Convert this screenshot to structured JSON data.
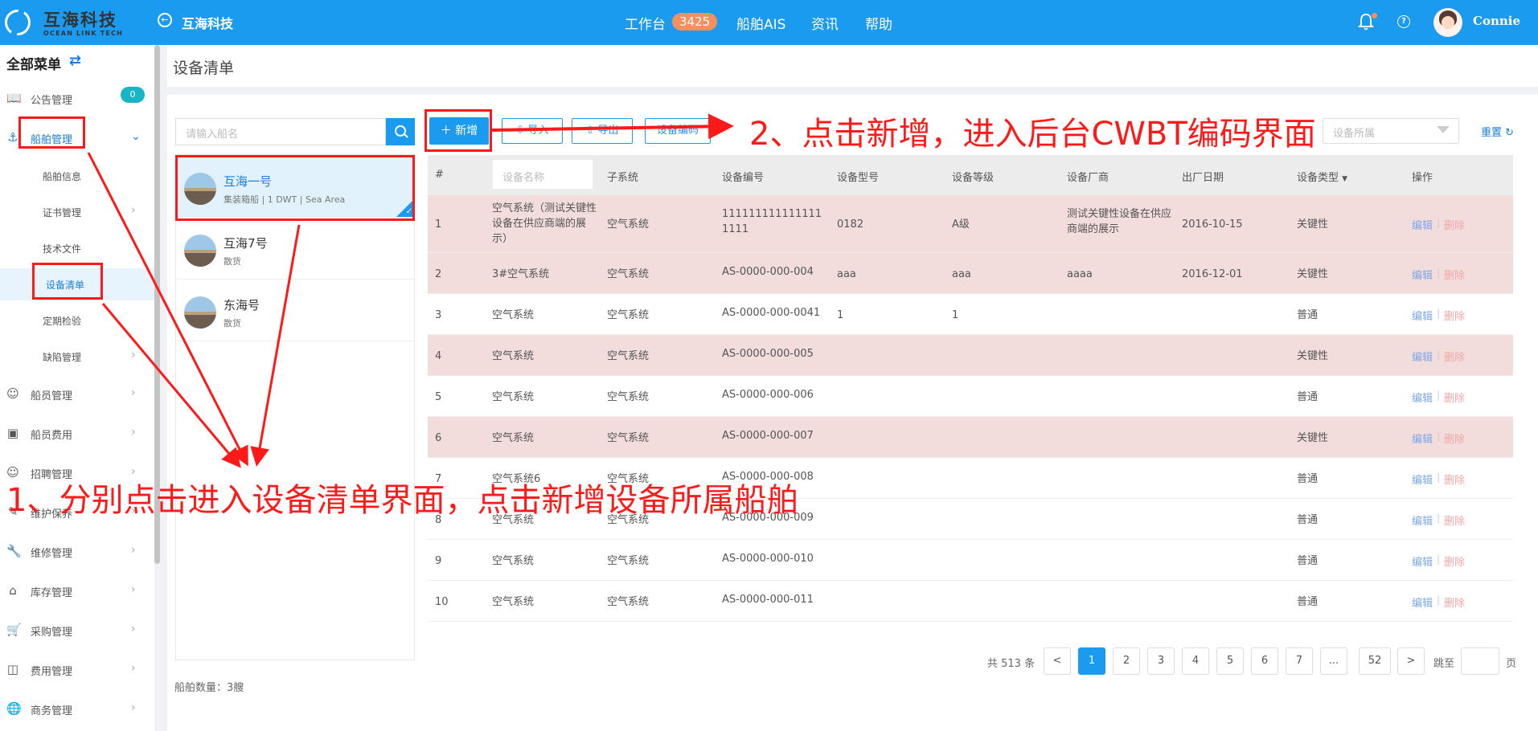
{
  "header": {
    "logo_cn": "互海科技",
    "logo_en": "OCEAN LINK TECH",
    "company": "互海科技",
    "nav": [
      {
        "label": "工作台",
        "badge": "3425"
      },
      {
        "label": "船舶AIS"
      },
      {
        "label": "资讯"
      },
      {
        "label": "帮助"
      }
    ],
    "username": "Connie",
    "help_glyph": "?"
  },
  "sidebar": {
    "title": "全部菜单",
    "swap_icon": "⇄",
    "notice_badge": "0",
    "items": [
      {
        "label": "公告管理",
        "icon": "book-icon"
      },
      {
        "label": "船舶管理",
        "icon": "anchor-icon"
      },
      {
        "label": "船舶信息"
      },
      {
        "label": "证书管理"
      },
      {
        "label": "技术文件"
      },
      {
        "label": "设备清单"
      },
      {
        "label": "定期检验"
      },
      {
        "label": "缺陷管理"
      },
      {
        "label": "船员管理",
        "icon": "user-icon"
      },
      {
        "label": "船员费用",
        "icon": "wallet-icon"
      },
      {
        "label": "招聘管理",
        "icon": "user-search-icon"
      },
      {
        "label": "维护保养",
        "icon": "brush-icon"
      },
      {
        "label": "维修管理",
        "icon": "wrench-icon"
      },
      {
        "label": "库存管理",
        "icon": "warehouse-icon"
      },
      {
        "label": "采购管理",
        "icon": "cart-icon"
      },
      {
        "label": "费用管理",
        "icon": "coins-icon"
      },
      {
        "label": "商务管理",
        "icon": "globe-icon"
      }
    ]
  },
  "page": {
    "title": "设备清单"
  },
  "ships": {
    "search_placeholder": "请输入船名",
    "list": [
      {
        "name": "互海一号",
        "desc": "集装箱船 | 1 DWT | Sea Area"
      },
      {
        "name": "互海7号",
        "desc": "散货"
      },
      {
        "name": "东海号",
        "desc": "散货"
      }
    ],
    "count_label": "船舶数量：",
    "count": "3艘"
  },
  "toolbar": {
    "add_label": "＋ 新增",
    "import_label": "导入",
    "export_label": "导出",
    "third_label": "设备编码",
    "filter_placeholder": "设备所属",
    "reset_label": "重置"
  },
  "table": {
    "headers": [
      "#",
      "设备名称",
      "子系统",
      "设备编号",
      "设备型号",
      "设备等级",
      "设备厂商",
      "出厂日期",
      "设备类型",
      "操作"
    ],
    "name_filter_placeholder": "设备名称",
    "sort_icon": "▼",
    "edit_label": "编辑",
    "delete_label": "删除",
    "separator": "|",
    "rows": [
      {
        "no": "1",
        "name": "空气系统（测试关键性设备在供应商端的展示）",
        "sub": "空气系统",
        "code": "1111111111111111111",
        "model": "0182",
        "grade": "A级",
        "vendor": "测试关键性设备在供应商端的展示",
        "date": "2016-10-15",
        "type": "关键性"
      },
      {
        "no": "2",
        "name": "3#空气系统",
        "sub": "空气系统",
        "code": "AS-0000-000-004",
        "model": "aaa",
        "grade": "aaa",
        "vendor": "aaaa",
        "date": "2016-12-01",
        "type": "关键性"
      },
      {
        "no": "3",
        "name": "空气系统",
        "sub": "空气系统",
        "code": "AS-0000-000-0041",
        "model": "1",
        "grade": "1",
        "vendor": "",
        "date": "",
        "type": "普通"
      },
      {
        "no": "4",
        "name": "空气系统",
        "sub": "空气系统",
        "code": "AS-0000-000-005",
        "model": "",
        "grade": "",
        "vendor": "",
        "date": "",
        "type": "关键性"
      },
      {
        "no": "5",
        "name": "空气系统",
        "sub": "空气系统",
        "code": "AS-0000-000-006",
        "model": "",
        "grade": "",
        "vendor": "",
        "date": "",
        "type": "普通"
      },
      {
        "no": "6",
        "name": "空气系统",
        "sub": "空气系统",
        "code": "AS-0000-000-007",
        "model": "",
        "grade": "",
        "vendor": "",
        "date": "",
        "type": "关键性"
      },
      {
        "no": "7",
        "name": "空气系统6",
        "sub": "空气系统",
        "code": "AS-0000-000-008",
        "model": "",
        "grade": "",
        "vendor": "",
        "date": "",
        "type": "普通"
      },
      {
        "no": "8",
        "name": "空气系统",
        "sub": "空气系统",
        "code": "AS-0000-000-009",
        "model": "",
        "grade": "",
        "vendor": "",
        "date": "",
        "type": "普通"
      },
      {
        "no": "9",
        "name": "空气系统",
        "sub": "空气系统",
        "code": "AS-0000-000-010",
        "model": "",
        "grade": "",
        "vendor": "",
        "date": "",
        "type": "普通"
      },
      {
        "no": "10",
        "name": "空气系统",
        "sub": "空气系统",
        "code": "AS-0000-000-011",
        "model": "",
        "grade": "",
        "vendor": "",
        "date": "",
        "type": "普通"
      }
    ]
  },
  "pagination": {
    "total": "共 513 条",
    "prev": "<",
    "next": ">",
    "pages": [
      "1",
      "2",
      "3",
      "4",
      "5",
      "6",
      "7",
      "...",
      "52"
    ],
    "current": "1",
    "jump_label": "跳至",
    "page_label": "页"
  },
  "annotations": {
    "note1": "1、分别点击进入设备清单界面，点击新增设备所属船舶",
    "note2": "2、点击新增，进入后台CWBT编码界面",
    "color": "#ff1a1a"
  }
}
